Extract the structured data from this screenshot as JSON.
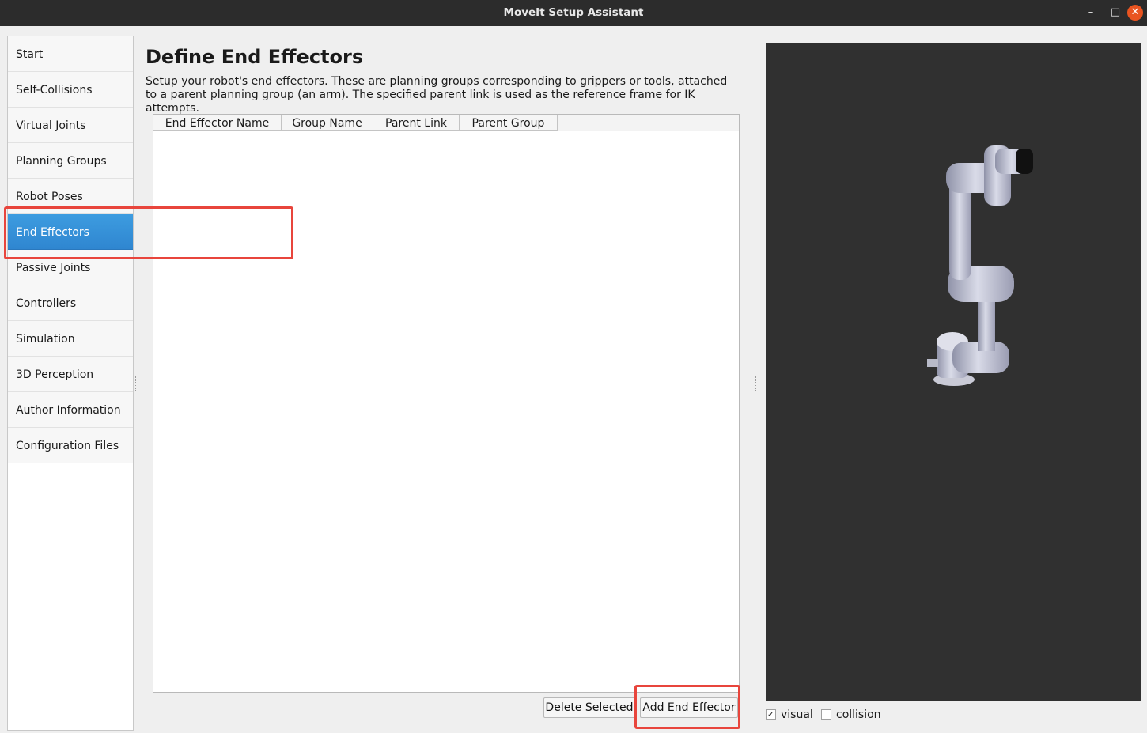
{
  "window": {
    "title": "MoveIt Setup Assistant",
    "min_label": "–",
    "max_label": "□",
    "close_label": "✕"
  },
  "sidebar": {
    "items": [
      {
        "label": "Start"
      },
      {
        "label": "Self-Collisions"
      },
      {
        "label": "Virtual Joints"
      },
      {
        "label": "Planning Groups"
      },
      {
        "label": "Robot Poses"
      },
      {
        "label": "End Effectors",
        "active": true
      },
      {
        "label": "Passive Joints"
      },
      {
        "label": "Controllers"
      },
      {
        "label": "Simulation"
      },
      {
        "label": "3D Perception"
      },
      {
        "label": "Author Information"
      },
      {
        "label": "Configuration Files"
      }
    ]
  },
  "main": {
    "title": "Define End Effectors",
    "description": "Setup your robot's end effectors. These are planning groups corresponding to grippers or tools, attached to a parent planning group (an arm). The specified parent link is used as the reference frame for IK attempts.",
    "table": {
      "columns": [
        "End Effector Name",
        "Group Name",
        "Parent Link",
        "Parent Group"
      ],
      "rows": []
    },
    "buttons": {
      "delete_selected": "Delete Selected",
      "add_end_effector": "Add End Effector"
    }
  },
  "viewer": {
    "visual_label": "visual",
    "visual_checked": true,
    "collision_label": "collision",
    "collision_checked": false
  },
  "colors": {
    "active_nav": "#2f86d0",
    "viewer_bg": "#303030",
    "annotation": "#e8453c",
    "titlebar": "#2c2c2c"
  }
}
